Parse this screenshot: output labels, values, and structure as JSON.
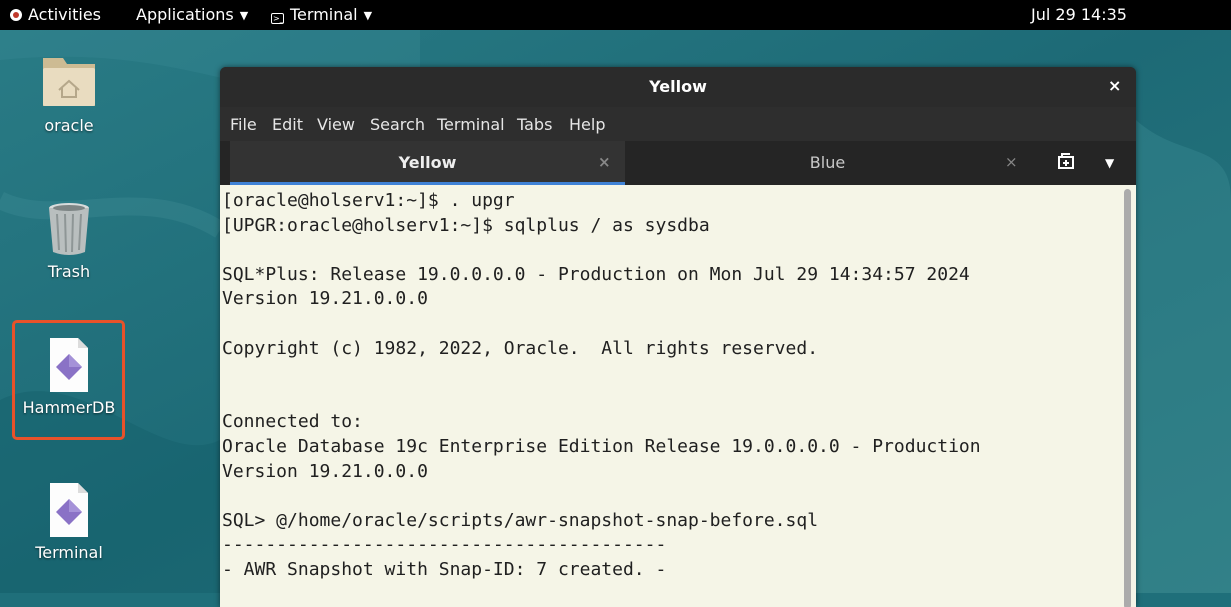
{
  "topbar": {
    "activities": "Activities",
    "applications": "Applications",
    "terminal": "Terminal",
    "clock": "Jul 29  14:35"
  },
  "desktop": {
    "icons": [
      {
        "label": "oracle"
      },
      {
        "label": "Trash"
      },
      {
        "label": "HammerDB"
      },
      {
        "label": "Terminal"
      }
    ]
  },
  "window": {
    "title": "Yellow",
    "close_glyph": "×",
    "menu": [
      "File",
      "Edit",
      "View",
      "Search",
      "Terminal",
      "Tabs",
      "Help"
    ],
    "tabs": [
      {
        "label": "Yellow",
        "close": "×"
      },
      {
        "label": "Blue",
        "close": "×"
      }
    ],
    "terminal_lines": [
      "[oracle@holserv1:~]$ . upgr",
      "[UPGR:oracle@holserv1:~]$ sqlplus / as sysdba",
      "",
      "SQL*Plus: Release 19.0.0.0.0 - Production on Mon Jul 29 14:34:57 2024",
      "Version 19.21.0.0.0",
      "",
      "Copyright (c) 1982, 2022, Oracle.  All rights reserved.",
      "",
      "",
      "Connected to:",
      "Oracle Database 19c Enterprise Edition Release 19.0.0.0.0 - Production",
      "Version 19.21.0.0.0",
      "",
      "SQL> @/home/oracle/scripts/awr-snapshot-snap-before.sql",
      "-----------------------------------------",
      "- AWR Snapshot with Snap-ID: 7 created. -"
    ]
  },
  "colors": {
    "highlight": "#e8522a",
    "tab_accent": "#3f82d6",
    "terminal_bg": "#f5f5e7"
  }
}
